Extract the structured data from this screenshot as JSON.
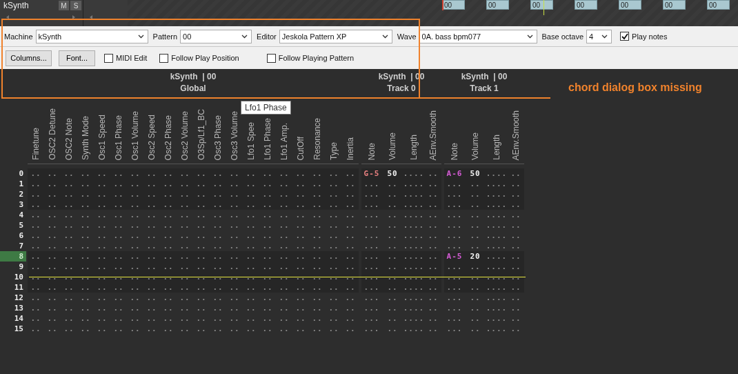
{
  "top_bar": {
    "track_name": "kSynth",
    "buttons": [
      "M",
      "S"
    ],
    "pattern_blocks": [
      "00",
      "00",
      "00",
      "00",
      "00",
      "00",
      "00"
    ]
  },
  "toolbar": {
    "fields": [
      {
        "label": "Machine",
        "value": "kSynth"
      },
      {
        "label": "Pattern",
        "value": "00"
      },
      {
        "label": "Editor",
        "value": "Jeskola Pattern XP"
      },
      {
        "label": "Wave",
        "value": "0A. bass bpm077"
      },
      {
        "label": "Base octave",
        "value": "4"
      }
    ],
    "play_notes": {
      "label": "Play notes",
      "checked": true
    },
    "buttons": [
      "Columns...",
      "Font..."
    ],
    "checkboxes": [
      {
        "label": "MIDI Edit",
        "checked": false
      },
      {
        "label": "Follow Play Position",
        "checked": false
      },
      {
        "label": "Follow Playing Pattern",
        "checked": false
      }
    ]
  },
  "annotation": {
    "text": "chord dialog box missing"
  },
  "tooltip": {
    "text": "Lfo1 Phase"
  },
  "pattern": {
    "groups": [
      {
        "kind": "global",
        "title": "kSynth  | 00",
        "name": "Global",
        "columns": [
          "Finetune",
          "OSC2 Detune",
          "OSC2 Note",
          "Synth Mode",
          "Osc1 Speed",
          "Osc1 Phase",
          "Osc1 Volume",
          "Osc2 Speed",
          "Osc2 Phase",
          "Osc2 Volume",
          "O3Sp/Lf1_BC",
          "Osc3 Phase",
          "Osc3 Volume",
          "Lfo1 Spee",
          "Lfo1 Phase",
          "Lfo1 Amp.",
          "CutOff",
          "Resonance",
          "Type",
          "Inertia"
        ]
      },
      {
        "kind": "track",
        "title": "kSynth  | 00",
        "name": "Track 0",
        "columns": [
          "Note",
          "Volume",
          "Length",
          "AEnv.Smooth"
        ]
      },
      {
        "kind": "track",
        "title": "kSynth  | 00",
        "name": "Track 1",
        "columns": [
          "Note",
          "Volume",
          "Length",
          "AEnv.Smooth"
        ]
      }
    ],
    "rows": [
      {
        "number": "0",
        "selected": false,
        "play_position": false,
        "cells": [
          [
            "..",
            "..",
            "..",
            "..",
            "..",
            "..",
            "..",
            "..",
            "..",
            "..",
            "..",
            "..",
            "..",
            "..",
            "..",
            "..",
            "..",
            "..",
            "..",
            ".."
          ],
          [
            {
              "text": "G-5",
              "color": "#e88080"
            },
            "50",
            "....",
            ".."
          ],
          [
            {
              "text": "A-6",
              "color": "#d65cd6"
            },
            "50",
            "....",
            ".."
          ]
        ]
      },
      {
        "number": "1",
        "selected": false,
        "play_position": false,
        "cells": [
          [
            "..",
            "..",
            "..",
            "..",
            "..",
            "..",
            "..",
            "..",
            "..",
            "..",
            "..",
            "..",
            "..",
            "..",
            "..",
            "..",
            "..",
            "..",
            "..",
            ".."
          ],
          [
            "...",
            "..",
            "....",
            ".."
          ],
          [
            "...",
            "..",
            "....",
            ".."
          ]
        ]
      },
      {
        "number": "2",
        "selected": false,
        "play_position": false,
        "cells": [
          [
            "..",
            "..",
            "..",
            "..",
            "..",
            "..",
            "..",
            "..",
            "..",
            "..",
            "..",
            "..",
            "..",
            "..",
            "..",
            "..",
            "..",
            "..",
            "..",
            ".."
          ],
          [
            "...",
            "..",
            "....",
            ".."
          ],
          [
            "...",
            "..",
            "....",
            ".."
          ]
        ]
      },
      {
        "number": "3",
        "selected": false,
        "play_position": false,
        "cells": [
          [
            "..",
            "..",
            "..",
            "..",
            "..",
            "..",
            "..",
            "..",
            "..",
            "..",
            "..",
            "..",
            "..",
            "..",
            "..",
            "..",
            "..",
            "..",
            "..",
            ".."
          ],
          [
            "...",
            "..",
            "....",
            ".."
          ],
          [
            "...",
            "..",
            "....",
            ".."
          ]
        ]
      },
      {
        "number": "4",
        "selected": false,
        "play_position": false,
        "cells": [
          [
            "..",
            "..",
            "..",
            "..",
            "..",
            "..",
            "..",
            "..",
            "..",
            "..",
            "..",
            "..",
            "..",
            "..",
            "..",
            "..",
            "..",
            "..",
            "..",
            ".."
          ],
          [
            "...",
            "..",
            "....",
            ".."
          ],
          [
            "...",
            "..",
            "....",
            ".."
          ]
        ]
      },
      {
        "number": "5",
        "selected": false,
        "play_position": false,
        "cells": [
          [
            "..",
            "..",
            "..",
            "..",
            "..",
            "..",
            "..",
            "..",
            "..",
            "..",
            "..",
            "..",
            "..",
            "..",
            "..",
            "..",
            "..",
            "..",
            "..",
            ".."
          ],
          [
            "...",
            "..",
            "....",
            ".."
          ],
          [
            "...",
            "..",
            "....",
            ".."
          ]
        ]
      },
      {
        "number": "6",
        "selected": false,
        "play_position": false,
        "cells": [
          [
            "..",
            "..",
            "..",
            "..",
            "..",
            "..",
            "..",
            "..",
            "..",
            "..",
            "..",
            "..",
            "..",
            "..",
            "..",
            "..",
            "..",
            "..",
            "..",
            ".."
          ],
          [
            "...",
            "..",
            "....",
            ".."
          ],
          [
            "...",
            "..",
            "....",
            ".."
          ]
        ]
      },
      {
        "number": "7",
        "selected": false,
        "play_position": false,
        "cells": [
          [
            "..",
            "..",
            "..",
            "..",
            "..",
            "..",
            "..",
            "..",
            "..",
            "..",
            "..",
            "..",
            "..",
            "..",
            "..",
            "..",
            "..",
            "..",
            "..",
            ".."
          ],
          [
            "...",
            "..",
            "....",
            ".."
          ],
          [
            "...",
            "..",
            "....",
            ".."
          ]
        ]
      },
      {
        "number": "8",
        "selected": true,
        "play_position": false,
        "cells": [
          [
            "..",
            "..",
            "..",
            "..",
            "..",
            "..",
            "..",
            "..",
            "..",
            "..",
            "..",
            "..",
            "..",
            "..",
            "..",
            "..",
            "..",
            "..",
            "..",
            ".."
          ],
          [
            "...",
            "..",
            "....",
            ".."
          ],
          [
            {
              "text": "A-5",
              "color": "#d65cd6"
            },
            "20",
            "....",
            ".."
          ]
        ]
      },
      {
        "number": "9",
        "selected": false,
        "play_position": false,
        "cells": [
          [
            "..",
            "..",
            "..",
            "..",
            "..",
            "..",
            "..",
            "..",
            "..",
            "..",
            "..",
            "..",
            "..",
            "..",
            "..",
            "..",
            "..",
            "..",
            "..",
            ".."
          ],
          [
            "...",
            "..",
            "....",
            ".."
          ],
          [
            "...",
            "..",
            "....",
            ".."
          ]
        ]
      },
      {
        "number": "10",
        "selected": false,
        "play_position": true,
        "cells": [
          [
            "..",
            "..",
            "..",
            "..",
            "..",
            "..",
            "..",
            "..",
            "..",
            "..",
            "..",
            "..",
            "..",
            "..",
            "..",
            "..",
            "..",
            "..",
            "..",
            ".."
          ],
          [
            "...",
            "..",
            "....",
            ".."
          ],
          [
            "...",
            "..",
            "....",
            ".."
          ]
        ]
      },
      {
        "number": "11",
        "selected": false,
        "play_position": false,
        "cells": [
          [
            "..",
            "..",
            "..",
            "..",
            "..",
            "..",
            "..",
            "..",
            "..",
            "..",
            "..",
            "..",
            "..",
            "..",
            "..",
            "..",
            "..",
            "..",
            "..",
            ".."
          ],
          [
            "...",
            "..",
            "....",
            ".."
          ],
          [
            "...",
            "..",
            "....",
            ".."
          ]
        ]
      },
      {
        "number": "12",
        "selected": false,
        "play_position": false,
        "cells": [
          [
            "..",
            "..",
            "..",
            "..",
            "..",
            "..",
            "..",
            "..",
            "..",
            "..",
            "..",
            "..",
            "..",
            "..",
            "..",
            "..",
            "..",
            "..",
            "..",
            ".."
          ],
          [
            "...",
            "..",
            "....",
            ".."
          ],
          [
            "...",
            "..",
            "....",
            ".."
          ]
        ]
      },
      {
        "number": "13",
        "selected": false,
        "play_position": false,
        "cells": [
          [
            "..",
            "..",
            "..",
            "..",
            "..",
            "..",
            "..",
            "..",
            "..",
            "..",
            "..",
            "..",
            "..",
            "..",
            "..",
            "..",
            "..",
            "..",
            "..",
            ".."
          ],
          [
            "...",
            "..",
            "....",
            ".."
          ],
          [
            "...",
            "..",
            "....",
            ".."
          ]
        ]
      },
      {
        "number": "14",
        "selected": false,
        "play_position": false,
        "cells": [
          [
            "..",
            "..",
            "..",
            "..",
            "..",
            "..",
            "..",
            "..",
            "..",
            "..",
            "..",
            "..",
            "..",
            "..",
            "..",
            "..",
            "..",
            "..",
            "..",
            ".."
          ],
          [
            "...",
            "..",
            "....",
            ".."
          ],
          [
            "...",
            "..",
            "....",
            ".."
          ]
        ]
      },
      {
        "number": "15",
        "selected": false,
        "play_position": false,
        "cells": [
          [
            "..",
            "..",
            "..",
            "..",
            "..",
            "..",
            "..",
            "..",
            "..",
            "..",
            "..",
            "..",
            "..",
            "..",
            "..",
            "..",
            "..",
            "..",
            "..",
            ".."
          ],
          [
            "...",
            "..",
            "....",
            ".."
          ],
          [
            "...",
            "..",
            "....",
            ".."
          ]
        ]
      }
    ]
  }
}
